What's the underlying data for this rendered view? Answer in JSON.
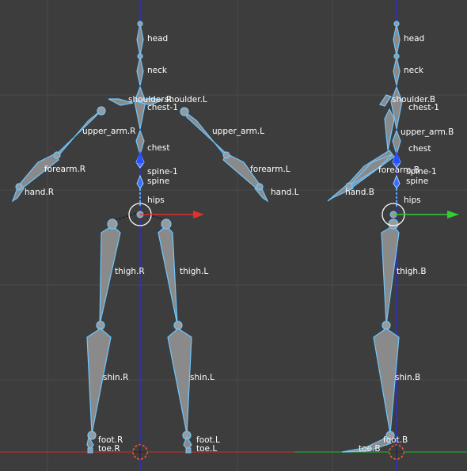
{
  "viewport": {
    "colors": {
      "background": "#3d3d3d",
      "grid": "#4a4a4a",
      "bone_outline": "#6fc7ff",
      "bone_fill": "#8a8a8a",
      "axis_x": "#e03030",
      "axis_y": "#30d030",
      "axis_z": "#3030c0",
      "cursor": "#ff5a2a"
    },
    "front_view": {
      "labels": {
        "head": "head",
        "neck": "neck",
        "shoulder_r": "shoulder.R",
        "shoulder_l": "shoulder.L",
        "chest_1": "chest-1",
        "upper_arm_r": "upper_arm.R",
        "upper_arm_l": "upper_arm.L",
        "chest": "chest",
        "forearm_r": "forearm.R",
        "forearm_l": "forearm.L",
        "spine_1": "spine-1",
        "spine": "spine",
        "hand_r": "hand.R",
        "hand_l": "hand.L",
        "hips": "hips",
        "thigh_r": "thigh.R",
        "thigh_l": "thigh.L",
        "shin_r": "shin.R",
        "shin_l": "shin.L",
        "foot_r": "foot.R",
        "toe_r": "toe.R",
        "foot_l": "foot.L",
        "toe_l": "toe.L"
      },
      "icons": {
        "cursor": "3d-cursor-icon",
        "manipulator": "transform-manipulator-icon"
      }
    },
    "side_view": {
      "labels": {
        "head": "head",
        "neck": "neck",
        "shoulder": "shoulder.B",
        "chest_1": "chest-1",
        "upper_arm": "upper_arm.B",
        "chest": "chest",
        "forearm": "forearm.B",
        "spine_1": "spine-1",
        "spine": "spine",
        "hand": "hand.B",
        "hips": "hips",
        "thigh": "thigh.B",
        "shin": "shin.B",
        "foot": "foot.B",
        "toe": "toe.B"
      },
      "icons": {
        "cursor": "3d-cursor-icon",
        "manipulator": "transform-manipulator-icon"
      }
    }
  }
}
